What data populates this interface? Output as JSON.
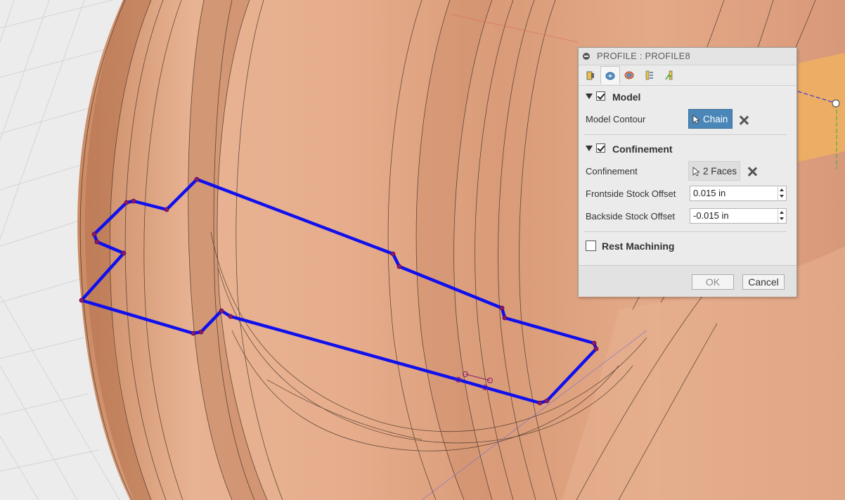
{
  "viewport": {
    "background_color": "#ececec",
    "grid_color": "#d6d6d6",
    "model_color": "#e0a27e",
    "model_shadow_color": "#b87652",
    "profile_color": "#1010ee",
    "vertex_color": "#8a1a6e"
  },
  "dialog": {
    "title": "PROFILE : PROFILE8",
    "tabs": [
      {
        "icon": "tool-tab-icon",
        "active": false
      },
      {
        "icon": "geometry-tab-icon",
        "active": true
      },
      {
        "icon": "heights-tab-icon",
        "active": false
      },
      {
        "icon": "passes-tab-icon",
        "active": false
      },
      {
        "icon": "linking-tab-icon",
        "active": false
      }
    ],
    "model": {
      "heading": "Model",
      "checked": true,
      "contour_label": "Model Contour",
      "chain_button": "Chain",
      "chain_color": "#4a86b8"
    },
    "confinement": {
      "heading": "Confinement",
      "checked": true,
      "label": "Confinement",
      "faces_button": "2 Faces",
      "frontside_label": "Frontside Stock Offset",
      "frontside_value": "0.015 in",
      "backside_label": "Backside Stock Offset",
      "backside_value": "-0.015 in"
    },
    "rest_machining": {
      "label": "Rest Machining",
      "checked": false
    },
    "ok_label": "OK",
    "cancel_label": "Cancel"
  }
}
